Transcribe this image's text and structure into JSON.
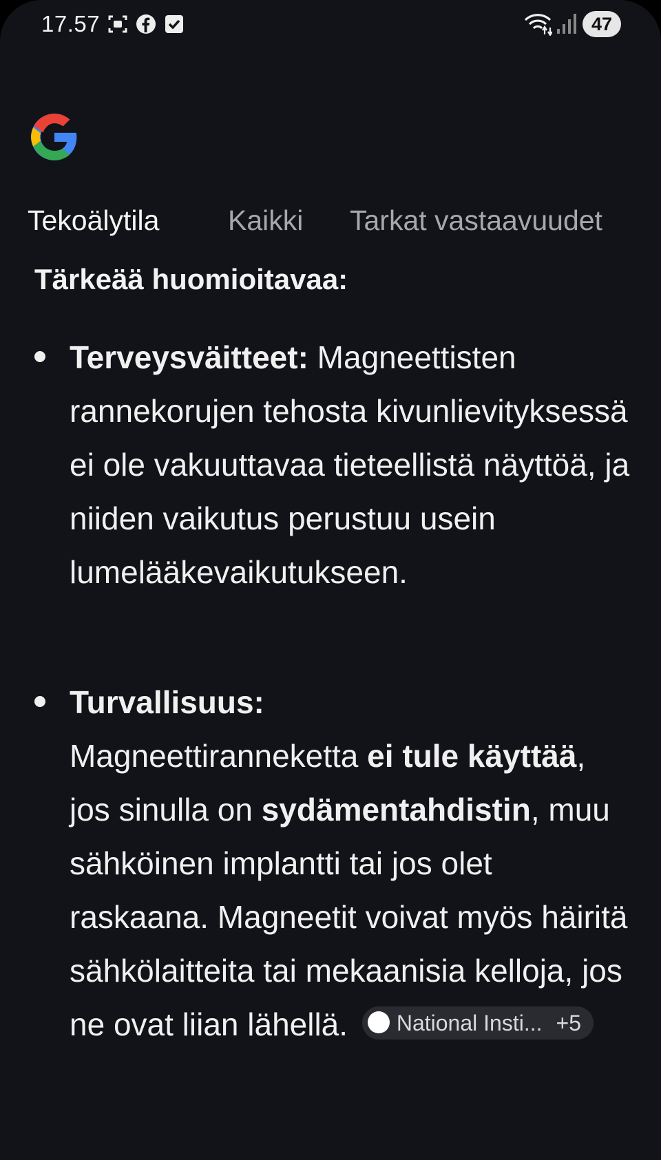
{
  "status_bar": {
    "time": "17.57",
    "battery": "47",
    "left_icons": [
      "screenshot-icon",
      "facebook-icon",
      "checkbox-icon"
    ],
    "right_icons": [
      "wifi-icon",
      "signal-icon"
    ]
  },
  "logo": {
    "name": "google-logo",
    "colors": [
      "#4285F4",
      "#EA4335",
      "#FBBC05",
      "#34A853"
    ]
  },
  "tabs": [
    {
      "label": "Tekoälytila",
      "active": true
    },
    {
      "label": "Kaikki",
      "active": false
    },
    {
      "label": "Tarkat vastaavuudet",
      "active": false
    }
  ],
  "content": {
    "heading": "Tärkeää huomioitavaa:",
    "bullets": [
      {
        "title": "Terveysväitteet:",
        "text": "Magneettisten rannekorujen tehosta kivunlievityksessä ei ole vakuuttavaa tieteellistä näyttöä, ja niiden vaikutus perustuu usein lumelääkevaikutukseen."
      },
      {
        "title": "Turvallisuus:",
        "text_1": "Magneettiranneketta",
        "bold_1": "ei tule käyttää",
        "text_2": ", jos sinulla on",
        "bold_2": "sydämentahdistin",
        "text_3": ", muu sähköinen implantti tai jos olet raskaana. Magneetit voivat myös häiritä sähkölaitteita tai mekaanisia kelloja, jos ne ovat liian lähellä."
      }
    ],
    "source_chip": {
      "label": "National Insti...",
      "more": "+5"
    }
  },
  "colors": {
    "background": "#121318",
    "text": "#f0f0f0",
    "muted": "#a7a7ad",
    "chip_bg": "#2a2b30"
  }
}
